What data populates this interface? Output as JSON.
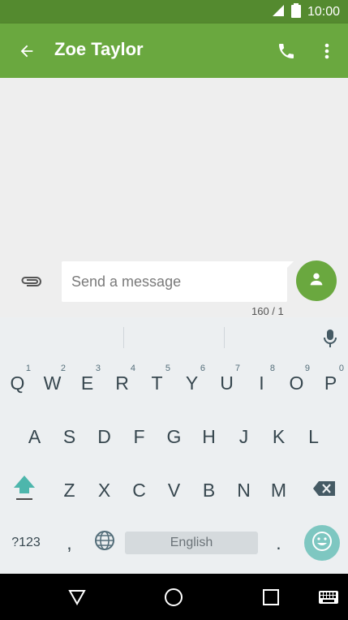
{
  "status_bar": {
    "time": "10:00",
    "icons": [
      "signal-icon",
      "battery-icon"
    ]
  },
  "app_bar": {
    "title": "Zoe Taylor",
    "icons": [
      "back-arrow-icon",
      "phone-icon",
      "more-vert-icon"
    ]
  },
  "composer": {
    "placeholder": "Send a message",
    "char_counter": "160 / 1",
    "icons": [
      "attach-icon",
      "contact-icon"
    ]
  },
  "suggestion_bar": {
    "icons": [
      "mic-icon"
    ]
  },
  "keyboard": {
    "row1": [
      {
        "label": "Q",
        "hint": "1"
      },
      {
        "label": "W",
        "hint": "2"
      },
      {
        "label": "E",
        "hint": "3"
      },
      {
        "label": "R",
        "hint": "4"
      },
      {
        "label": "T",
        "hint": "5"
      },
      {
        "label": "Y",
        "hint": "6"
      },
      {
        "label": "U",
        "hint": "7"
      },
      {
        "label": "I",
        "hint": "8"
      },
      {
        "label": "O",
        "hint": "9"
      },
      {
        "label": "P",
        "hint": "0"
      }
    ],
    "row2": [
      "A",
      "S",
      "D",
      "F",
      "G",
      "H",
      "J",
      "K",
      "L"
    ],
    "row3": [
      "Z",
      "X",
      "C",
      "V",
      "B",
      "N",
      "M"
    ],
    "symbols_key": "?123",
    "comma_key": ",",
    "period_key": ".",
    "space_label": "English",
    "icons": [
      "shift-icon",
      "backspace-icon",
      "globe-icon",
      "emoji-icon"
    ],
    "accent_color": "#7ec7c1"
  },
  "nav_bar": {
    "icons": [
      "back-triangle-icon",
      "home-circle-icon",
      "recents-square-icon",
      "keyboard-icon"
    ]
  }
}
